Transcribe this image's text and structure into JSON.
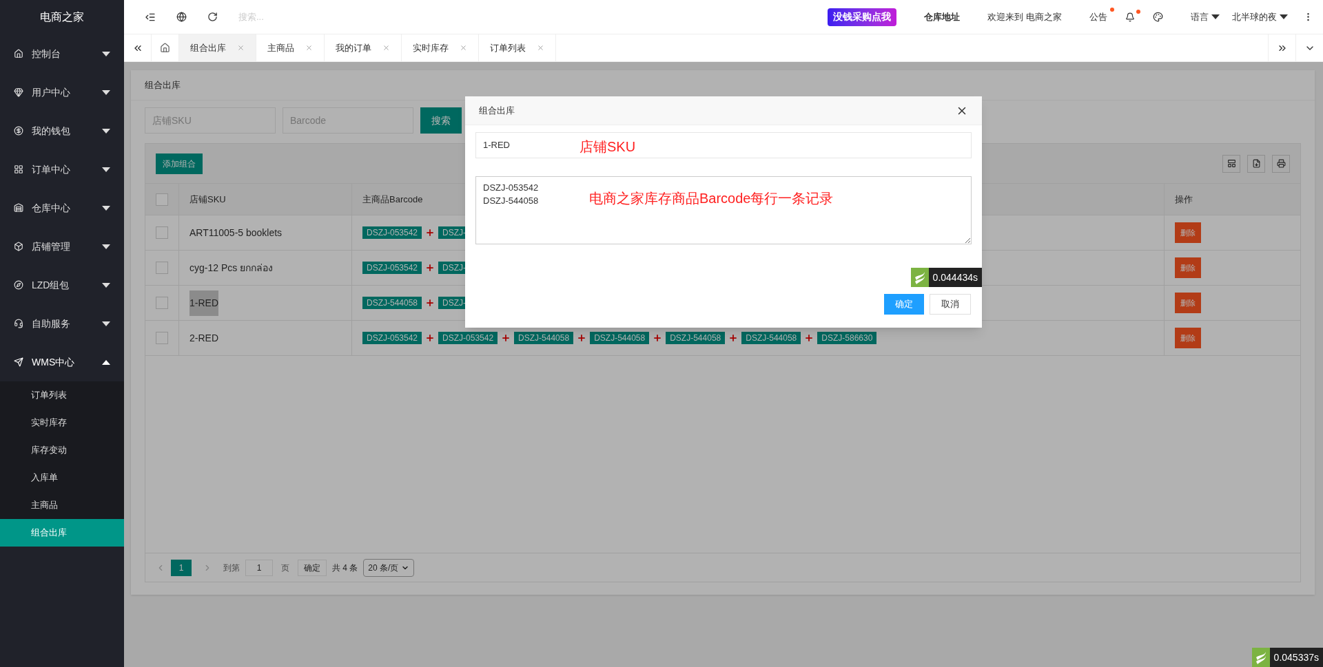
{
  "logo": "电商之家",
  "header": {
    "search": {
      "placeholder": "搜索..."
    },
    "promo": "没钱采购点我",
    "warehouse": "仓库地址",
    "welcome": "欢迎来到 电商之家",
    "notice": {
      "label": "公告",
      "dot": true
    },
    "bell": {
      "dot": true
    },
    "language": "语言",
    "user": "北半球的夜"
  },
  "sidebar": {
    "items": [
      {
        "label": "控制台",
        "expanded": false
      },
      {
        "label": "用户中心",
        "expanded": false
      },
      {
        "label": "我的钱包",
        "expanded": false
      },
      {
        "label": "订单中心",
        "expanded": false
      },
      {
        "label": "仓库中心",
        "expanded": false
      },
      {
        "label": "店铺管理",
        "expanded": false
      },
      {
        "label": "LZD组包",
        "expanded": false
      },
      {
        "label": "自助服务",
        "expanded": false
      },
      {
        "label": "WMS中心",
        "expanded": true,
        "children": [
          {
            "label": "订单列表",
            "selected": false
          },
          {
            "label": "实时库存",
            "selected": false
          },
          {
            "label": "库存变动",
            "selected": false
          },
          {
            "label": "入库单",
            "selected": false
          },
          {
            "label": "主商品",
            "selected": false
          },
          {
            "label": "组合出库",
            "selected": true
          }
        ]
      }
    ]
  },
  "tabs": [
    {
      "label": "组合出库",
      "selected": true
    },
    {
      "label": "主商品",
      "selected": false
    },
    {
      "label": "我的订单",
      "selected": false
    },
    {
      "label": "实时库存",
      "selected": false
    },
    {
      "label": "订单列表",
      "selected": false
    }
  ],
  "page": {
    "title": "组合出库",
    "filters": [
      {
        "placeholder": "店铺SKU"
      },
      {
        "placeholder": "Barcode"
      }
    ],
    "search_button": "搜索",
    "add_button": "添加组合",
    "table": {
      "header_checked": false,
      "columns": [
        "店铺SKU",
        "主商品Barcode",
        "操作"
      ],
      "rows": [
        {
          "checked": false,
          "sku": "ART11005-5 booklets",
          "highlighted": false,
          "barcodes": [
            "DSZJ-053542",
            "DSZJ-"
          ],
          "action": "删除"
        },
        {
          "checked": false,
          "sku": "cyg-12 Pcs ยกกล่อง",
          "highlighted": false,
          "barcodes": [
            "DSZJ-053542",
            "DSZJ-"
          ],
          "action": "删除"
        },
        {
          "checked": false,
          "sku": "1-RED",
          "highlighted": true,
          "barcodes": [
            "DSZJ-544058",
            "DSZJ-"
          ],
          "action": "删除"
        },
        {
          "checked": false,
          "sku": "2-RED",
          "highlighted": false,
          "barcodes": [
            "DSZJ-053542",
            "DSZJ-053542",
            "DSZJ-544058",
            "DSZJ-544058",
            "DSZJ-544058",
            "DSZJ-544058",
            "DSZJ-586630"
          ],
          "action": "删除"
        }
      ]
    },
    "pagination": {
      "pages": [
        {
          "label": "1",
          "selected": true
        }
      ],
      "goto_label": "到第",
      "goto_value": "1",
      "page_unit": "页",
      "confirm": "确定",
      "total": "共 4 条",
      "page_size": "20 条/页"
    }
  },
  "modal": {
    "title": "组合出库",
    "sku_value": "1-RED",
    "sku_note": "店铺SKU",
    "barcodes_value": "DSZJ-053542\nDSZJ-544058",
    "barcodes_note": "电商之家库存商品Barcode每行一条记录",
    "timing": "0.044434s",
    "ok": "确定",
    "cancel": "取消"
  },
  "page_timing": "0.045337s"
}
